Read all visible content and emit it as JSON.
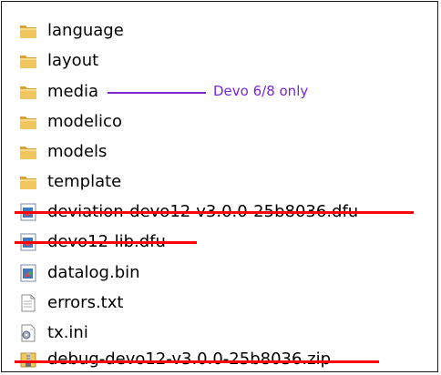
{
  "files": [
    {
      "name": "language",
      "icon": "folder-icon",
      "struck": false
    },
    {
      "name": "layout",
      "icon": "folder-icon",
      "struck": false
    },
    {
      "name": "media",
      "icon": "folder-icon",
      "struck": false
    },
    {
      "name": "modelico",
      "icon": "folder-icon",
      "struck": false
    },
    {
      "name": "models",
      "icon": "folder-icon",
      "struck": false
    },
    {
      "name": "template",
      "icon": "folder-icon",
      "struck": false
    },
    {
      "name": "deviation-devo12-v3.0.0-25b8036.dfu",
      "icon": "dfu-file-icon",
      "struck": true
    },
    {
      "name": "devo12-lib.dfu",
      "icon": "dfu-file-icon",
      "struck": true
    },
    {
      "name": "datalog.bin",
      "icon": "bin-file-icon",
      "struck": false
    },
    {
      "name": "errors.txt",
      "icon": "text-file-icon",
      "struck": false
    },
    {
      "name": "tx.ini",
      "icon": "ini-file-icon",
      "struck": false
    },
    {
      "name": "debug-devo12-v3.0.0-25b8036.zip",
      "icon": "zip-file-icon",
      "struck": true
    }
  ],
  "annotation": {
    "text": "Devo 6/8 only",
    "color": "#7a28d0"
  },
  "colors": {
    "strike": "#ff0000",
    "folder": "#e8b84a"
  }
}
